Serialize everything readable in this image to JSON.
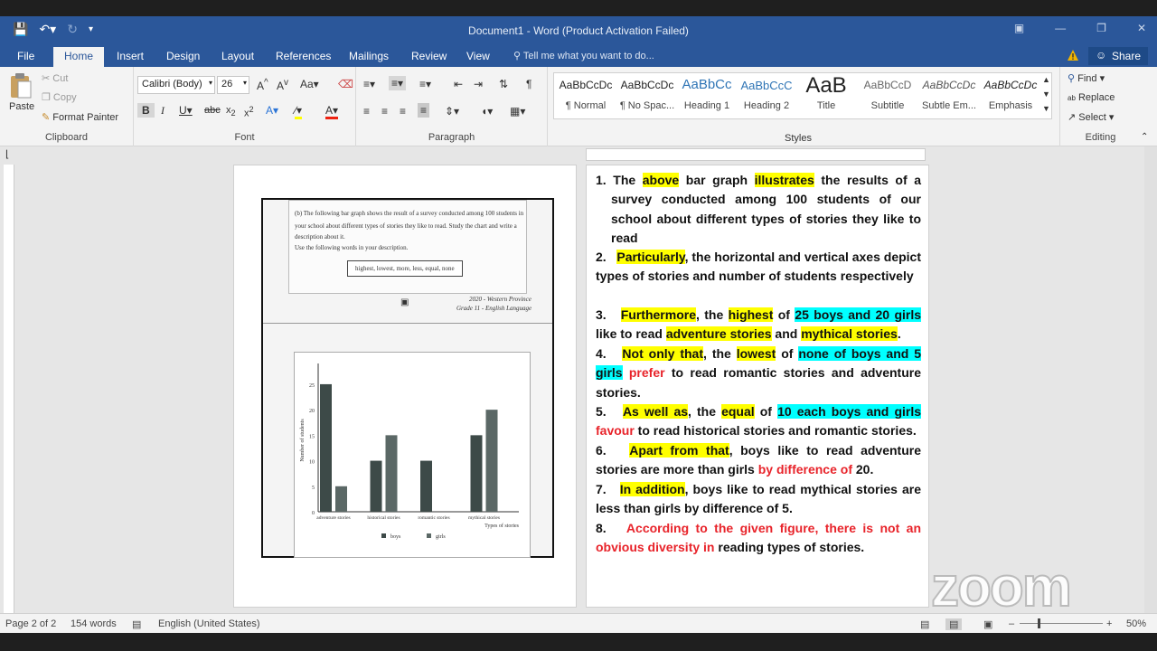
{
  "window": {
    "title": "Document1 - Word (Product Activation Failed)",
    "share_label": "Share"
  },
  "tabs": [
    "File",
    "Home",
    "Insert",
    "Design",
    "Layout",
    "References",
    "Mailings",
    "Review",
    "View"
  ],
  "tell_me": "Tell me what you want to do...",
  "clipboard": {
    "paste": "Paste",
    "cut": "Cut",
    "copy": "Copy",
    "format_painter": "Format Painter",
    "group_label": "Clipboard"
  },
  "font": {
    "name": "Calibri (Body)",
    "size": "26",
    "group_label": "Font"
  },
  "paragraph": {
    "group_label": "Paragraph"
  },
  "styles": {
    "group_label": "Styles",
    "items": [
      {
        "preview": "AaBbCcDc",
        "name": "¶ Normal"
      },
      {
        "preview": "AaBbCcDc",
        "name": "¶ No Spac..."
      },
      {
        "preview": "AaBbCc",
        "name": "Heading 1"
      },
      {
        "preview": "AaBbCcC",
        "name": "Heading 2"
      },
      {
        "preview": "AaB",
        "name": "Title"
      },
      {
        "preview": "AaBbCcD",
        "name": "Subtitle"
      },
      {
        "preview": "AaBbCcDc",
        "name": "Subtle Em..."
      },
      {
        "preview": "AaBbCcDc",
        "name": "Emphasis"
      }
    ]
  },
  "editing": {
    "find": "Find",
    "replace": "Replace",
    "select": "Select",
    "group_label": "Editing"
  },
  "scan": {
    "question_line1": "(b) The following bar graph shows the result of a survey conducted among 100 students in",
    "question_line2": "your school about different types of stories they like to read. Study the chart and write a",
    "question_line3": "description about it.",
    "question_line4": "Use the following words in your description.",
    "word_box": "highest, lowest, more, less, equal, none",
    "source_line1": "2020 - Western Province",
    "source_line2": "Grade 11 - English Language"
  },
  "chart_data": {
    "type": "bar",
    "categories": [
      "adventure stories",
      "historical stories",
      "romantic stories",
      "mythical stories"
    ],
    "series": [
      {
        "name": "boys",
        "values": [
          25,
          10,
          10,
          15
        ]
      },
      {
        "name": "girls",
        "values": [
          5,
          15,
          0,
          20
        ]
      }
    ],
    "ylabel": "Number of students",
    "xlabel": "Types of stories",
    "yticks": [
      "0",
      "5",
      "10",
      "15",
      "20",
      "25"
    ],
    "ylim": [
      0,
      28
    ],
    "colors": {
      "boys": "#3d4a48",
      "girls": "#5b6866"
    },
    "legend": "bottom"
  },
  "essay": {
    "p1": {
      "num": "1.",
      "a": "The ",
      "b": "above",
      "c": " bar graph ",
      "d": "illustrates",
      "e": " the results of a survey conducted among 100 students of our school about different types of stories they like to read"
    },
    "p2": {
      "num": "2.",
      "a": "Particularly",
      "b": ", the horizontal and vertical axes depict types of stories and number of students respectively"
    },
    "p3": {
      "num": "3.",
      "a": "Furthermore",
      "b": ", the ",
      "c": "highest",
      "d": " of ",
      "e": "25 boys and 20 girls",
      "f": " like to read ",
      "g": "adventure stories",
      "h": " and ",
      "i": "mythical stories",
      "j": "."
    },
    "p4": {
      "num": "4.",
      "a": "Not only that",
      "b": ", the ",
      "c": "lowest",
      "d": " of ",
      "e": "none of boys and 5 girls",
      "f": " prefer",
      "g": " to read romantic stories and adventure stories."
    },
    "p5": {
      "num": "5.",
      "a": "As well as",
      "b": ", the ",
      "c": "equal",
      "d": " of ",
      "e": "10 each boys and girls",
      "f": " favour",
      "g": " to read historical stories and romantic stories."
    },
    "p6": {
      "num": "6.",
      "a": "Apart from that",
      "b": ", boys like to read adventure stories are more than girls ",
      "c": "by difference of",
      "d": " 20."
    },
    "p7": {
      "num": "7.",
      "a": "In addition",
      "b": ", boys like to read mythical stories are less than girls by difference of 5."
    },
    "p8": {
      "num": "8.",
      "a": "According to the given figure, there is not an obvious diversity in",
      "b": " reading types of stories."
    }
  },
  "status": {
    "page": "Page 2 of 2",
    "words": "154 words",
    "language": "English (United States)",
    "zoom": "50%"
  },
  "overlay": {
    "logo_text": "zoom"
  }
}
